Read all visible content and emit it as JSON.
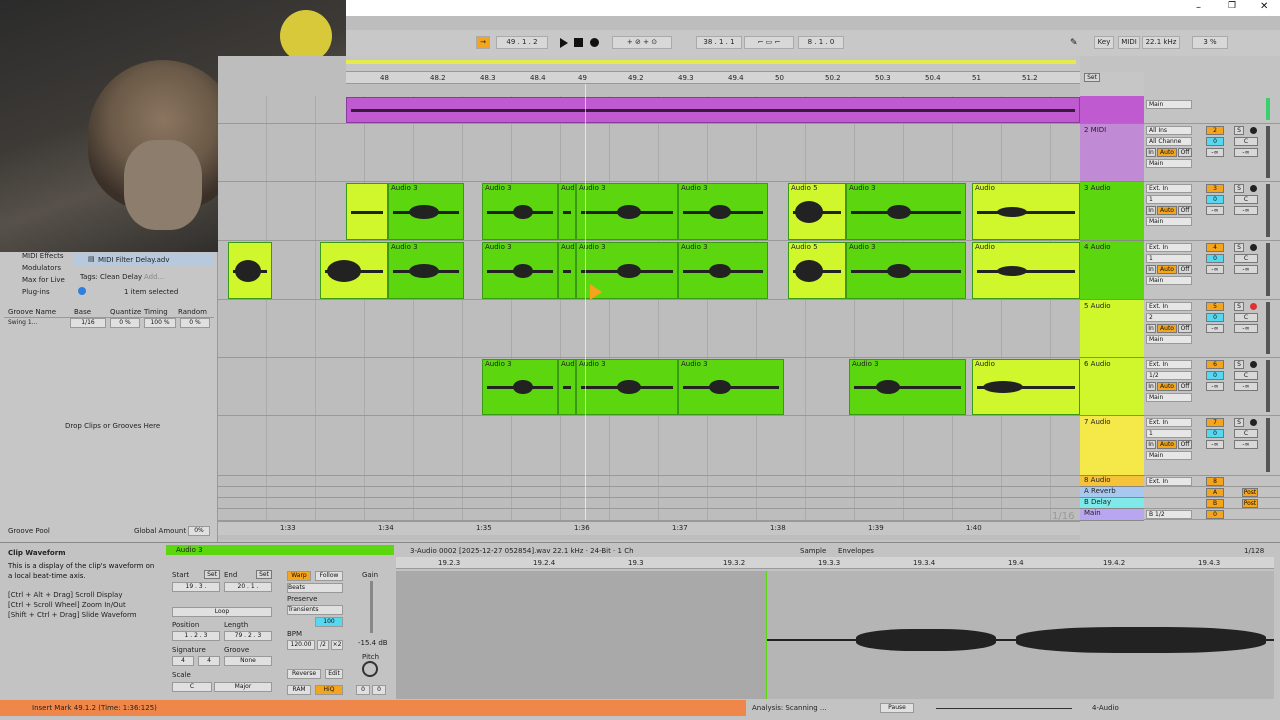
{
  "colors": {
    "audio_clip": "#5bd60f",
    "audio_clip_lime": "#d0f62c",
    "midi_clip": "#c05ad0",
    "status_bar": "#f0874a",
    "main_track": "#b8a6f0"
  },
  "transport": {
    "arrangement_pos": "49 . 1 . 2",
    "punch_start": "38 . 1 . 1",
    "loop_length": "8 . 1 . 0",
    "key_label": "Key",
    "midi_label": "MIDI",
    "sample_rate": "22.1 kHz",
    "cpu": "3 %"
  },
  "browser": {
    "categories": [
      "MIDI Effects",
      "Modulators",
      "Max for Live",
      "Plug-ins"
    ],
    "selected_file": "MIDI Filter Delay.adv",
    "tags_label": "Tags:",
    "tag": "Clean Delay",
    "add_label": "Add...",
    "count": "1 item selected"
  },
  "groove": {
    "headers": [
      "Groove Name",
      "Base",
      "Quantize",
      "Timing",
      "Random"
    ],
    "row": {
      "name": "Swing 1...",
      "base": "1/16",
      "quantize": "0 %",
      "timing": "100 %",
      "random": "0 %"
    },
    "drop": "Drop Clips or Grooves Here",
    "footer": "Groove Pool",
    "global_label": "Global Amount",
    "global_value": "0%"
  },
  "ruler": {
    "bars": [
      "48",
      "48.2",
      "48.3",
      "48.4",
      "49",
      "49.2",
      "49.3",
      "49.4",
      "50",
      "50.2",
      "50.3",
      "50.4",
      "51",
      "51.2"
    ],
    "time": [
      "1:33",
      "1:34",
      "1:35",
      "1:36",
      "1:37",
      "1:38",
      "1:39",
      "1:40"
    ],
    "zoom": "1/16",
    "set_label": "Set"
  },
  "tracks": [
    {
      "name": "",
      "type": "midi",
      "input": "Main"
    },
    {
      "name": "2 MIDI",
      "num": "2",
      "input": "All Ins",
      "channel": "All Channe",
      "output": "Main"
    },
    {
      "name": "3 Audio",
      "num": "3",
      "input": "Ext. In",
      "channel": "1",
      "output": "Main"
    },
    {
      "name": "4 Audio",
      "num": "4",
      "input": "Ext. In",
      "channel": "1",
      "output": "Main"
    },
    {
      "name": "5 Audio",
      "num": "5",
      "input": "Ext. In",
      "channel": "2",
      "output": "Main"
    },
    {
      "name": "6 Audio",
      "num": "6",
      "input": "Ext. In",
      "channel": "1/2",
      "output": "Main"
    },
    {
      "name": "7 Audio",
      "num": "7",
      "input": "Ext. In",
      "channel": "1",
      "output": "Main"
    },
    {
      "name": "8 Audio",
      "num": "8",
      "input": "Ext. In"
    },
    {
      "name": "A Reverb",
      "num": "A",
      "post": "Post"
    },
    {
      "name": "B Delay",
      "num": "B",
      "post": "Post"
    },
    {
      "name": "Main",
      "num": "0",
      "input": "B 1/2"
    }
  ],
  "clip_names": {
    "a3": "Audio 3",
    "a5": "Audio 5",
    "au": "Audio",
    "aud": "Aud"
  },
  "mixer_labels": {
    "in": "In",
    "auto": "Auto",
    "off": "Off",
    "s": "S",
    "c": "C",
    "inf": "-∞",
    "solo": "S"
  },
  "info": {
    "title": "Clip Waveform",
    "body": "This is a display of the clip's waveform on a local beat-time axis.",
    "h1": "[Ctrl + Alt + Drag] Scroll Display",
    "h2": "[Ctrl + Scroll Wheel] Zoom In/Out",
    "h3": "[Shift + Ctrl + Drag] Slide Waveform"
  },
  "clip": {
    "name": "Audio 3",
    "start_label": "Start",
    "end_label": "End",
    "set": "Set",
    "start": "19 . 3 .",
    "end": "20 . 1 .",
    "loop": "Loop",
    "position_label": "Position",
    "length_label": "Length",
    "position": "1 . 2 . 3",
    "length": "79 . 2 . 3",
    "signature_label": "Signature",
    "groove_label": "Groove",
    "sig_num": "4",
    "sig_den": "4",
    "groove_val": "None",
    "scale_label": "Scale",
    "scale_root": "C",
    "scale_mode": "Major",
    "warp": "Warp",
    "follow": "Follow",
    "beats": "Beats",
    "preserve": "Preserve",
    "transients": "Transients",
    "grain": "100",
    "bpm_label": "BPM",
    "bpm": "120.00",
    "half": "/2",
    "double": "×2",
    "reverse": "Reverse",
    "edit": "Edit",
    "ram": "RAM",
    "hiq": "HiQ",
    "gain_label": "Gain",
    "gain": "-15.4 dB",
    "pitch_label": "Pitch",
    "pitch": "0",
    "cents": "0",
    "file": "3-Audio 0002 [2025-12-27 052854].wav  22.1 kHz · 24-Bit · 1 Ch",
    "sample_tab": "Sample",
    "env_tab": "Envelopes",
    "ratio": "1/128"
  },
  "sample_ruler": [
    "19.2.3",
    "19.2.4",
    "19.3",
    "19.3.2",
    "19.3.3",
    "19.3.4",
    "19.4",
    "19.4.2",
    "19.4.3"
  ],
  "status": {
    "message": "Insert Mark 49.1.2 (Time: 1:36:125)",
    "analysis": "Analysis: Scanning ...",
    "pause": "Pause",
    "track": "4-Audio"
  }
}
